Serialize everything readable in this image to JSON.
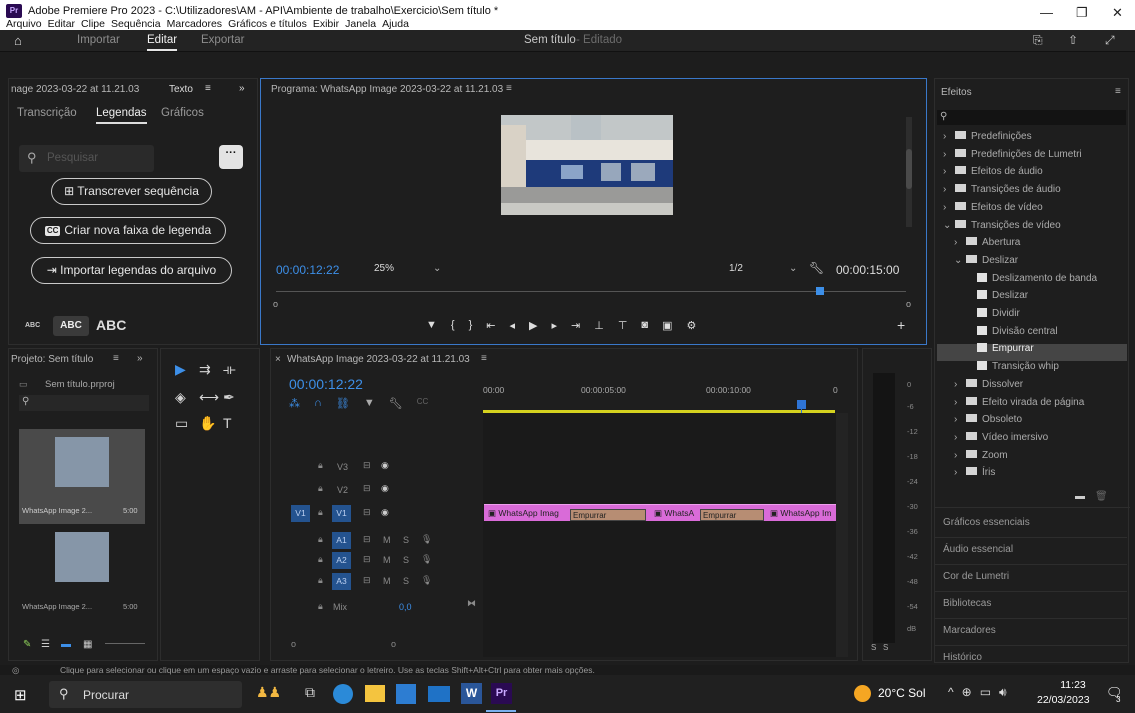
{
  "window": {
    "title": "Adobe Premiere Pro 2023 - C:\\Utilizadores\\AM - API\\Ambiente de trabalho\\Exercicio\\Sem título *",
    "badge": "Pr",
    "menu": [
      "Arquivo",
      "Editar",
      "Clipe",
      "Sequência",
      "Marcadores",
      "Gráficos e títulos",
      "Exibir",
      "Janela",
      "Ajuda"
    ],
    "controls": [
      "—",
      "❐",
      "✕"
    ]
  },
  "appbar": {
    "tabs": [
      "Importar",
      "Editar",
      "Exportar"
    ],
    "active": "Editar",
    "doc_title": "Sem título",
    "doc_state": "- Editado"
  },
  "text_panel": {
    "header_left": "nage 2023-03-22 at 11.21.03",
    "header_right": "Texto",
    "tabs": [
      "Transcrição",
      "Legendas",
      "Gráficos"
    ],
    "active_tab": "Legendas",
    "search_placeholder": "Pesquisar",
    "btn_transcribe": "Transcrever sequência",
    "btn_new_caption": "Criar nova faixa de legenda",
    "btn_import": "Importar legendas do arquivo",
    "sizes": [
      "ABC",
      "ABC",
      "ABC"
    ],
    "cc_badge": "CC"
  },
  "program": {
    "title": "Programa: WhatsApp Image 2023-03-22 at 11.21.03",
    "timecode": "00:00:12:22",
    "zoom": "25%",
    "quality": "1/2",
    "duration": "00:00:15:00"
  },
  "project": {
    "title": "Projeto: Sem título",
    "file": "Sem título.prproj",
    "items": [
      {
        "name": "WhatsApp Image 2...",
        "dur": "5:00"
      },
      {
        "name": "WhatsApp Image 2...",
        "dur": "5:00"
      }
    ]
  },
  "timeline": {
    "title": "WhatsApp Image 2023-03-22 at 11.21.03",
    "timecode": "00:00:12:22",
    "ruler": [
      "00:00",
      "00:00:05:00",
      "00:00:10:00",
      "0"
    ],
    "tracks": [
      "V3",
      "V2",
      "V1",
      "A1",
      "A2",
      "A3"
    ],
    "mix_label": "Mix",
    "mix_value": "0,0",
    "source_patch": "V1",
    "letters": {
      "m": "M",
      "s": "S"
    },
    "clips": [
      "WhatsApp Imag",
      "WhatsA",
      "WhatsApp Im"
    ],
    "transitions": [
      "Empurrar",
      "Empurrar"
    ]
  },
  "meter": {
    "labels": [
      "0",
      "-6",
      "-12",
      "-18",
      "-24",
      "-30",
      "-36",
      "-42",
      "-48",
      "-54",
      "dB"
    ],
    "solo": [
      "S",
      "S"
    ]
  },
  "effects": {
    "title": "Efeitos",
    "tree": [
      {
        "label": "Predefinições",
        "depth": 0,
        "type": "preset",
        "arrow": "›"
      },
      {
        "label": "Predefinições de Lumetri",
        "depth": 0,
        "type": "preset",
        "arrow": "›"
      },
      {
        "label": "Efeitos de áudio",
        "depth": 0,
        "type": "folder",
        "arrow": "›"
      },
      {
        "label": "Transições de áudio",
        "depth": 0,
        "type": "folder",
        "arrow": "›"
      },
      {
        "label": "Efeitos de vídeo",
        "depth": 0,
        "type": "folder",
        "arrow": "›"
      },
      {
        "label": "Transições de vídeo",
        "depth": 0,
        "type": "folder",
        "arrow": "⌄"
      },
      {
        "label": "Abertura",
        "depth": 1,
        "type": "folder",
        "arrow": "›"
      },
      {
        "label": "Deslizar",
        "depth": 1,
        "type": "folder",
        "arrow": "⌄"
      },
      {
        "label": "Deslizamento de banda",
        "depth": 2,
        "type": "fx",
        "arrow": ""
      },
      {
        "label": "Deslizar",
        "depth": 2,
        "type": "fx",
        "arrow": ""
      },
      {
        "label": "Dividir",
        "depth": 2,
        "type": "fx",
        "arrow": ""
      },
      {
        "label": "Divisão central",
        "depth": 2,
        "type": "fx",
        "arrow": ""
      },
      {
        "label": "Empurrar",
        "depth": 2,
        "type": "fx",
        "arrow": "",
        "selected": true
      },
      {
        "label": "Transição whip",
        "depth": 2,
        "type": "fx",
        "arrow": ""
      },
      {
        "label": "Dissolver",
        "depth": 1,
        "type": "folder",
        "arrow": "›"
      },
      {
        "label": "Efeito virada de página",
        "depth": 1,
        "type": "folder",
        "arrow": "›"
      },
      {
        "label": "Obsoleto",
        "depth": 1,
        "type": "folder",
        "arrow": "›"
      },
      {
        "label": "Vídeo imersivo",
        "depth": 1,
        "type": "folder",
        "arrow": "›"
      },
      {
        "label": "Zoom",
        "depth": 1,
        "type": "folder",
        "arrow": "›"
      },
      {
        "label": "Íris",
        "depth": 1,
        "type": "folder",
        "arrow": "›"
      }
    ],
    "panels": [
      "Gráficos essenciais",
      "Áudio essencial",
      "Cor de Lumetri",
      "Bibliotecas",
      "Marcadores",
      "Histórico"
    ]
  },
  "status": {
    "text": "Clique para selecionar ou clique em um espaço vazio e arraste para selecionar o letreiro. Use as teclas Shift+Alt+Ctrl para obter mais opções."
  },
  "taskbar": {
    "search": "Procurar",
    "weather": "20°C Sol",
    "time": "11:23",
    "date": "22/03/2023",
    "notif_count": "3",
    "app_badge_word": "W",
    "app_badge_pr": "Pr"
  },
  "colors": {
    "accent_blue": "#3d8fe8",
    "clip_pink": "#d96bd8",
    "transition": "#b78d73",
    "playhead": "#2e74d6",
    "ruler_yellow": "#d5d21f"
  }
}
